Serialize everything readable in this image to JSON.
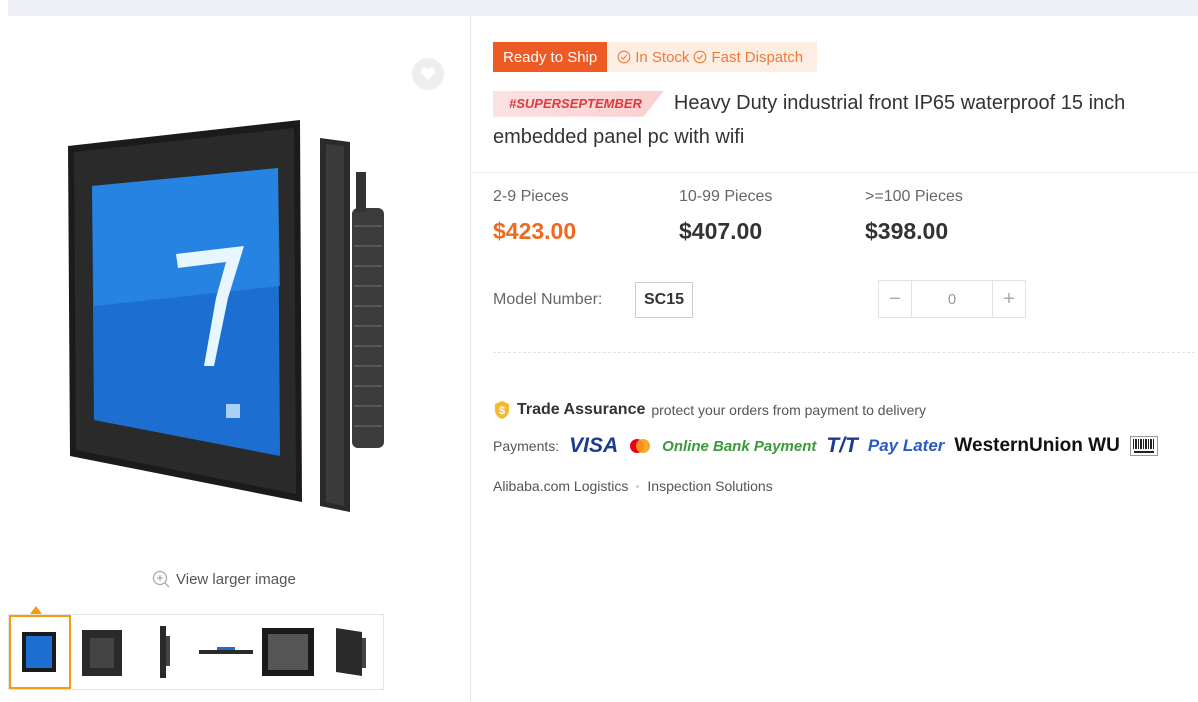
{
  "product": {
    "ready_label": "Ready to Ship",
    "stock_label": "In Stock",
    "dispatch_label": "Fast Dispatch",
    "promo_tag": "#SUPERSEPTEMBER",
    "title": "Heavy Duty industrial front IP65 waterproof 15 inch embedded panel pc with wifi"
  },
  "gallery": {
    "view_larger": "View larger image",
    "active_thumb": 0,
    "thumb_count": 6
  },
  "price_tiers": [
    {
      "qty": "2-9 Pieces",
      "price": "$423.00"
    },
    {
      "qty": "10-99 Pieces",
      "price": "$407.00"
    },
    {
      "qty": ">=100 Pieces",
      "price": "$398.00"
    }
  ],
  "model": {
    "label": "Model Number:",
    "value": "SC15"
  },
  "quantity": {
    "value": "0",
    "minus": "−",
    "plus": "+"
  },
  "trade_assurance": {
    "title": "Trade Assurance",
    "desc": "protect your orders from payment to delivery"
  },
  "payments": {
    "label": "Payments:",
    "methods": [
      "VISA",
      "Online Bank Payment",
      "T/T",
      "Pay Later",
      "WesternUnion",
      "WU"
    ]
  },
  "services": [
    "Alibaba.com Logistics",
    "Inspection Solutions"
  ],
  "colors": {
    "accent": "#ee5a24",
    "price_highlight": "#ee6a1f",
    "thumb_active": "#f39c12"
  }
}
